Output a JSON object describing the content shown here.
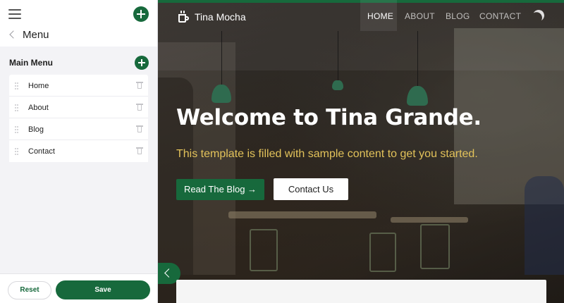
{
  "sidebar": {
    "back_label": "Menu",
    "section_title": "Main Menu",
    "items": [
      {
        "label": "Home"
      },
      {
        "label": "About"
      },
      {
        "label": "Blog"
      },
      {
        "label": "Contact"
      }
    ],
    "reset_label": "Reset",
    "save_label": "Save"
  },
  "site": {
    "title": "Tina Mocha",
    "nav": [
      {
        "label": "HOME",
        "active": true
      },
      {
        "label": "ABOUT",
        "active": false
      },
      {
        "label": "BLOG",
        "active": false
      },
      {
        "label": "CONTACT",
        "active": false
      }
    ]
  },
  "hero": {
    "title": "Welcome to Tina Grande.",
    "subtitle": "This template is filled with sample content to get you started.",
    "primary_button": "Read The Blog →",
    "secondary_button": "Contact Us"
  },
  "colors": {
    "accent": "#17693c",
    "subtitle": "#e2c25a",
    "sidebar_bg": "#f3f3f6"
  },
  "icons": [
    "hamburger-icon",
    "plus-icon",
    "chevron-left-icon",
    "drag-handle-icon",
    "trash-icon",
    "coffee-cup-icon",
    "moon-icon"
  ]
}
